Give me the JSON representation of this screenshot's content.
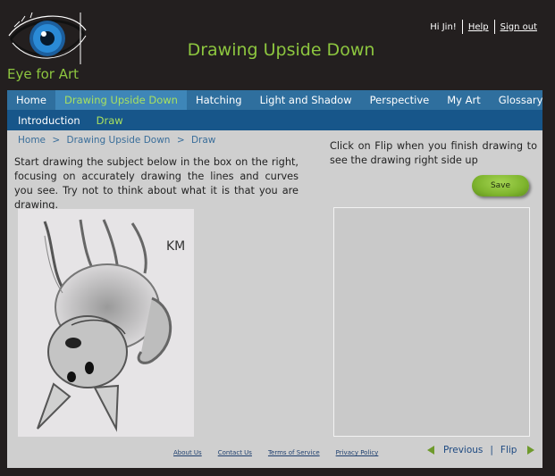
{
  "logo": {
    "text": "Eye for Art"
  },
  "site": {
    "title": "Drawing Upside Down"
  },
  "user": {
    "greeting": "Hi Jin!",
    "help": "Help",
    "signout": "Sign out"
  },
  "nav": {
    "items": [
      {
        "label": "Home"
      },
      {
        "label": "Drawing Upside Down"
      },
      {
        "label": "Hatching"
      },
      {
        "label": "Light and Shadow"
      },
      {
        "label": "Perspective"
      }
    ],
    "right": [
      {
        "label": "My Art"
      },
      {
        "label": "Glossary"
      }
    ],
    "active_index": 1
  },
  "subnav": {
    "items": [
      {
        "label": "Introduction"
      },
      {
        "label": "Draw"
      }
    ],
    "active_index": 1
  },
  "breadcrumb": {
    "items": [
      "Home",
      "Drawing Upside Down",
      "Draw"
    ],
    "separator": ">"
  },
  "instructions": "Start drawing the subject below in the box on the right, focusing on accurately drawing the lines and curves you see. Try not to think about what it is that you are drawing.",
  "flip_note": "Click on Flip when you finish drawing to see the drawing right side up",
  "save_button": "Save",
  "subject": {
    "signature": "KM",
    "icon": "upside-down-dog-sketch"
  },
  "footer": {
    "links": [
      "About Us",
      "Contact Us",
      "Terms of Service",
      "Privacy Policy"
    ]
  },
  "pager": {
    "previous": "Previous",
    "separator": "|",
    "flip": "Flip"
  },
  "colors": {
    "accent": "#8dc63f",
    "nav": "#2f6f9e",
    "subnav": "#17568a",
    "background": "#231f1f",
    "panel": "#cfcfcf"
  }
}
